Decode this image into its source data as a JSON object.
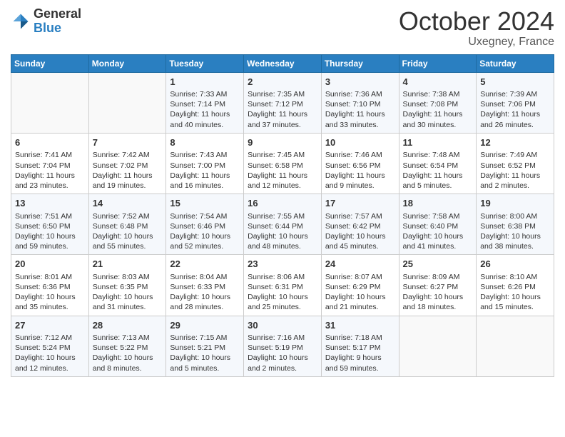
{
  "logo": {
    "general": "General",
    "blue": "Blue"
  },
  "title": {
    "month": "October 2024",
    "location": "Uxegney, France"
  },
  "headers": [
    "Sunday",
    "Monday",
    "Tuesday",
    "Wednesday",
    "Thursday",
    "Friday",
    "Saturday"
  ],
  "weeks": [
    [
      {
        "day": "",
        "sunrise": "",
        "sunset": "",
        "daylight": ""
      },
      {
        "day": "",
        "sunrise": "",
        "sunset": "",
        "daylight": ""
      },
      {
        "day": "1",
        "sunrise": "Sunrise: 7:33 AM",
        "sunset": "Sunset: 7:14 PM",
        "daylight": "Daylight: 11 hours and 40 minutes."
      },
      {
        "day": "2",
        "sunrise": "Sunrise: 7:35 AM",
        "sunset": "Sunset: 7:12 PM",
        "daylight": "Daylight: 11 hours and 37 minutes."
      },
      {
        "day": "3",
        "sunrise": "Sunrise: 7:36 AM",
        "sunset": "Sunset: 7:10 PM",
        "daylight": "Daylight: 11 hours and 33 minutes."
      },
      {
        "day": "4",
        "sunrise": "Sunrise: 7:38 AM",
        "sunset": "Sunset: 7:08 PM",
        "daylight": "Daylight: 11 hours and 30 minutes."
      },
      {
        "day": "5",
        "sunrise": "Sunrise: 7:39 AM",
        "sunset": "Sunset: 7:06 PM",
        "daylight": "Daylight: 11 hours and 26 minutes."
      }
    ],
    [
      {
        "day": "6",
        "sunrise": "Sunrise: 7:41 AM",
        "sunset": "Sunset: 7:04 PM",
        "daylight": "Daylight: 11 hours and 23 minutes."
      },
      {
        "day": "7",
        "sunrise": "Sunrise: 7:42 AM",
        "sunset": "Sunset: 7:02 PM",
        "daylight": "Daylight: 11 hours and 19 minutes."
      },
      {
        "day": "8",
        "sunrise": "Sunrise: 7:43 AM",
        "sunset": "Sunset: 7:00 PM",
        "daylight": "Daylight: 11 hours and 16 minutes."
      },
      {
        "day": "9",
        "sunrise": "Sunrise: 7:45 AM",
        "sunset": "Sunset: 6:58 PM",
        "daylight": "Daylight: 11 hours and 12 minutes."
      },
      {
        "day": "10",
        "sunrise": "Sunrise: 7:46 AM",
        "sunset": "Sunset: 6:56 PM",
        "daylight": "Daylight: 11 hours and 9 minutes."
      },
      {
        "day": "11",
        "sunrise": "Sunrise: 7:48 AM",
        "sunset": "Sunset: 6:54 PM",
        "daylight": "Daylight: 11 hours and 5 minutes."
      },
      {
        "day": "12",
        "sunrise": "Sunrise: 7:49 AM",
        "sunset": "Sunset: 6:52 PM",
        "daylight": "Daylight: 11 hours and 2 minutes."
      }
    ],
    [
      {
        "day": "13",
        "sunrise": "Sunrise: 7:51 AM",
        "sunset": "Sunset: 6:50 PM",
        "daylight": "Daylight: 10 hours and 59 minutes."
      },
      {
        "day": "14",
        "sunrise": "Sunrise: 7:52 AM",
        "sunset": "Sunset: 6:48 PM",
        "daylight": "Daylight: 10 hours and 55 minutes."
      },
      {
        "day": "15",
        "sunrise": "Sunrise: 7:54 AM",
        "sunset": "Sunset: 6:46 PM",
        "daylight": "Daylight: 10 hours and 52 minutes."
      },
      {
        "day": "16",
        "sunrise": "Sunrise: 7:55 AM",
        "sunset": "Sunset: 6:44 PM",
        "daylight": "Daylight: 10 hours and 48 minutes."
      },
      {
        "day": "17",
        "sunrise": "Sunrise: 7:57 AM",
        "sunset": "Sunset: 6:42 PM",
        "daylight": "Daylight: 10 hours and 45 minutes."
      },
      {
        "day": "18",
        "sunrise": "Sunrise: 7:58 AM",
        "sunset": "Sunset: 6:40 PM",
        "daylight": "Daylight: 10 hours and 41 minutes."
      },
      {
        "day": "19",
        "sunrise": "Sunrise: 8:00 AM",
        "sunset": "Sunset: 6:38 PM",
        "daylight": "Daylight: 10 hours and 38 minutes."
      }
    ],
    [
      {
        "day": "20",
        "sunrise": "Sunrise: 8:01 AM",
        "sunset": "Sunset: 6:36 PM",
        "daylight": "Daylight: 10 hours and 35 minutes."
      },
      {
        "day": "21",
        "sunrise": "Sunrise: 8:03 AM",
        "sunset": "Sunset: 6:35 PM",
        "daylight": "Daylight: 10 hours and 31 minutes."
      },
      {
        "day": "22",
        "sunrise": "Sunrise: 8:04 AM",
        "sunset": "Sunset: 6:33 PM",
        "daylight": "Daylight: 10 hours and 28 minutes."
      },
      {
        "day": "23",
        "sunrise": "Sunrise: 8:06 AM",
        "sunset": "Sunset: 6:31 PM",
        "daylight": "Daylight: 10 hours and 25 minutes."
      },
      {
        "day": "24",
        "sunrise": "Sunrise: 8:07 AM",
        "sunset": "Sunset: 6:29 PM",
        "daylight": "Daylight: 10 hours and 21 minutes."
      },
      {
        "day": "25",
        "sunrise": "Sunrise: 8:09 AM",
        "sunset": "Sunset: 6:27 PM",
        "daylight": "Daylight: 10 hours and 18 minutes."
      },
      {
        "day": "26",
        "sunrise": "Sunrise: 8:10 AM",
        "sunset": "Sunset: 6:26 PM",
        "daylight": "Daylight: 10 hours and 15 minutes."
      }
    ],
    [
      {
        "day": "27",
        "sunrise": "Sunrise: 7:12 AM",
        "sunset": "Sunset: 5:24 PM",
        "daylight": "Daylight: 10 hours and 12 minutes."
      },
      {
        "day": "28",
        "sunrise": "Sunrise: 7:13 AM",
        "sunset": "Sunset: 5:22 PM",
        "daylight": "Daylight: 10 hours and 8 minutes."
      },
      {
        "day": "29",
        "sunrise": "Sunrise: 7:15 AM",
        "sunset": "Sunset: 5:21 PM",
        "daylight": "Daylight: 10 hours and 5 minutes."
      },
      {
        "day": "30",
        "sunrise": "Sunrise: 7:16 AM",
        "sunset": "Sunset: 5:19 PM",
        "daylight": "Daylight: 10 hours and 2 minutes."
      },
      {
        "day": "31",
        "sunrise": "Sunrise: 7:18 AM",
        "sunset": "Sunset: 5:17 PM",
        "daylight": "Daylight: 9 hours and 59 minutes."
      },
      {
        "day": "",
        "sunrise": "",
        "sunset": "",
        "daylight": ""
      },
      {
        "day": "",
        "sunrise": "",
        "sunset": "",
        "daylight": ""
      }
    ]
  ]
}
